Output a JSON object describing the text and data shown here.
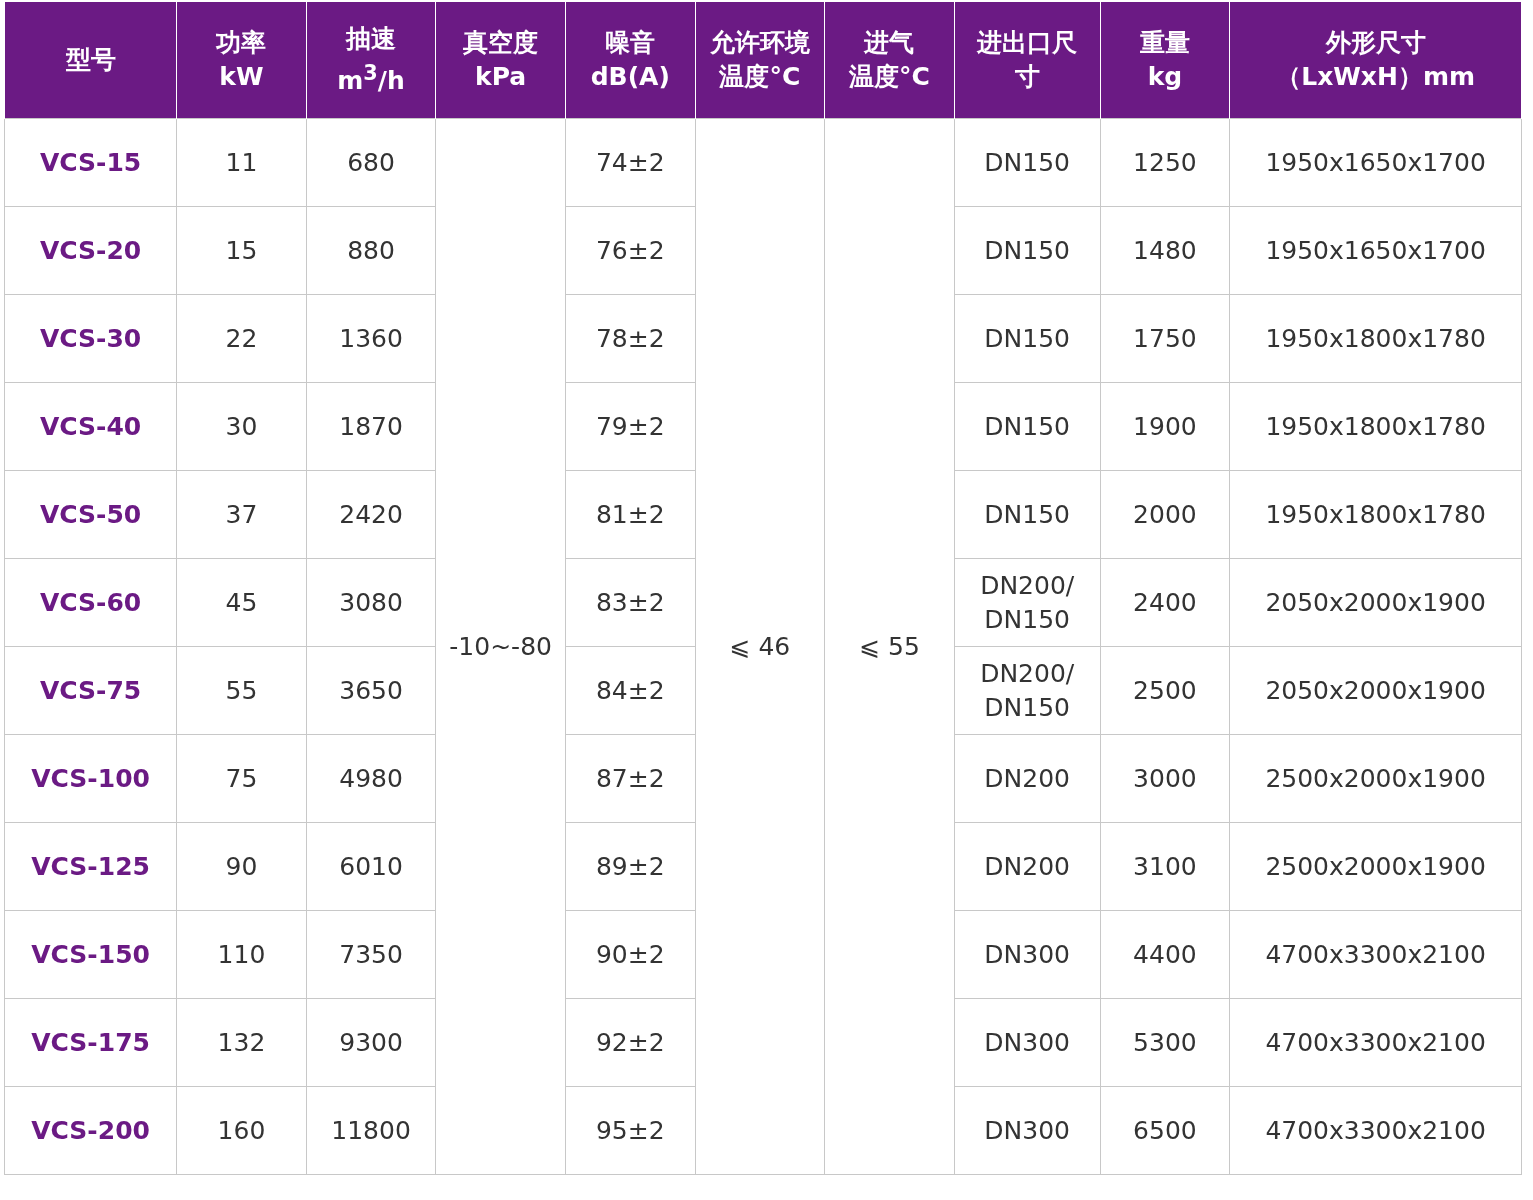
{
  "table": {
    "columns": [
      [
        "型号"
      ],
      [
        "功率",
        "kW"
      ],
      [
        "抽速",
        "m$^{3}$/h"
      ],
      [
        "真空度",
        "kPa"
      ],
      [
        "噪音",
        "dB(A)"
      ],
      [
        "允许环境",
        "温度°C"
      ],
      [
        "进气",
        "温度°C"
      ],
      [
        "进出口尺",
        "寸"
      ],
      [
        "重量",
        "kg"
      ],
      [
        "外形尺寸",
        "（LxWxH）mm"
      ]
    ],
    "shared": {
      "vacuum": "-10~-80",
      "ambient_temp": "⩽ 46",
      "inlet_temp": "⩽ 55"
    },
    "rows": [
      {
        "model": "VCS-15",
        "power": "11",
        "speed": "680",
        "noise": "74±2",
        "port": "DN150",
        "weight": "1250",
        "size": "1950x1650x1700"
      },
      {
        "model": "VCS-20",
        "power": "15",
        "speed": "880",
        "noise": "76±2",
        "port": "DN150",
        "weight": "1480",
        "size": "1950x1650x1700"
      },
      {
        "model": "VCS-30",
        "power": "22",
        "speed": "1360",
        "noise": "78±2",
        "port": "DN150",
        "weight": "1750",
        "size": "1950x1800x1780"
      },
      {
        "model": "VCS-40",
        "power": "30",
        "speed": "1870",
        "noise": "79±2",
        "port": "DN150",
        "weight": "1900",
        "size": "1950x1800x1780"
      },
      {
        "model": "VCS-50",
        "power": "37",
        "speed": "2420",
        "noise": "81±2",
        "port": "DN150",
        "weight": "2000",
        "size": "1950x1800x1780"
      },
      {
        "model": "VCS-60",
        "power": "45",
        "speed": "3080",
        "noise": "83±2",
        "port": "DN200/\nDN150",
        "weight": "2400",
        "size": "2050x2000x1900"
      },
      {
        "model": "VCS-75",
        "power": "55",
        "speed": "3650",
        "noise": "84±2",
        "port": "DN200/\nDN150",
        "weight": "2500",
        "size": "2050x2000x1900"
      },
      {
        "model": "VCS-100",
        "power": "75",
        "speed": "4980",
        "noise": "87±2",
        "port": "DN200",
        "weight": "3000",
        "size": "2500x2000x1900"
      },
      {
        "model": "VCS-125",
        "power": "90",
        "speed": "6010",
        "noise": "89±2",
        "port": "DN200",
        "weight": "3100",
        "size": "2500x2000x1900"
      },
      {
        "model": "VCS-150",
        "power": "110",
        "speed": "7350",
        "noise": "90±2",
        "port": "DN300",
        "weight": "4400",
        "size": "4700x3300x2100"
      },
      {
        "model": "VCS-175",
        "power": "132",
        "speed": "9300",
        "noise": "92±2",
        "port": "DN300",
        "weight": "5300",
        "size": "4700x3300x2100"
      },
      {
        "model": "VCS-200",
        "power": "160",
        "speed": "11800",
        "noise": "95±2",
        "port": "DN300",
        "weight": "6500",
        "size": "4700x3300x2100"
      }
    ]
  }
}
